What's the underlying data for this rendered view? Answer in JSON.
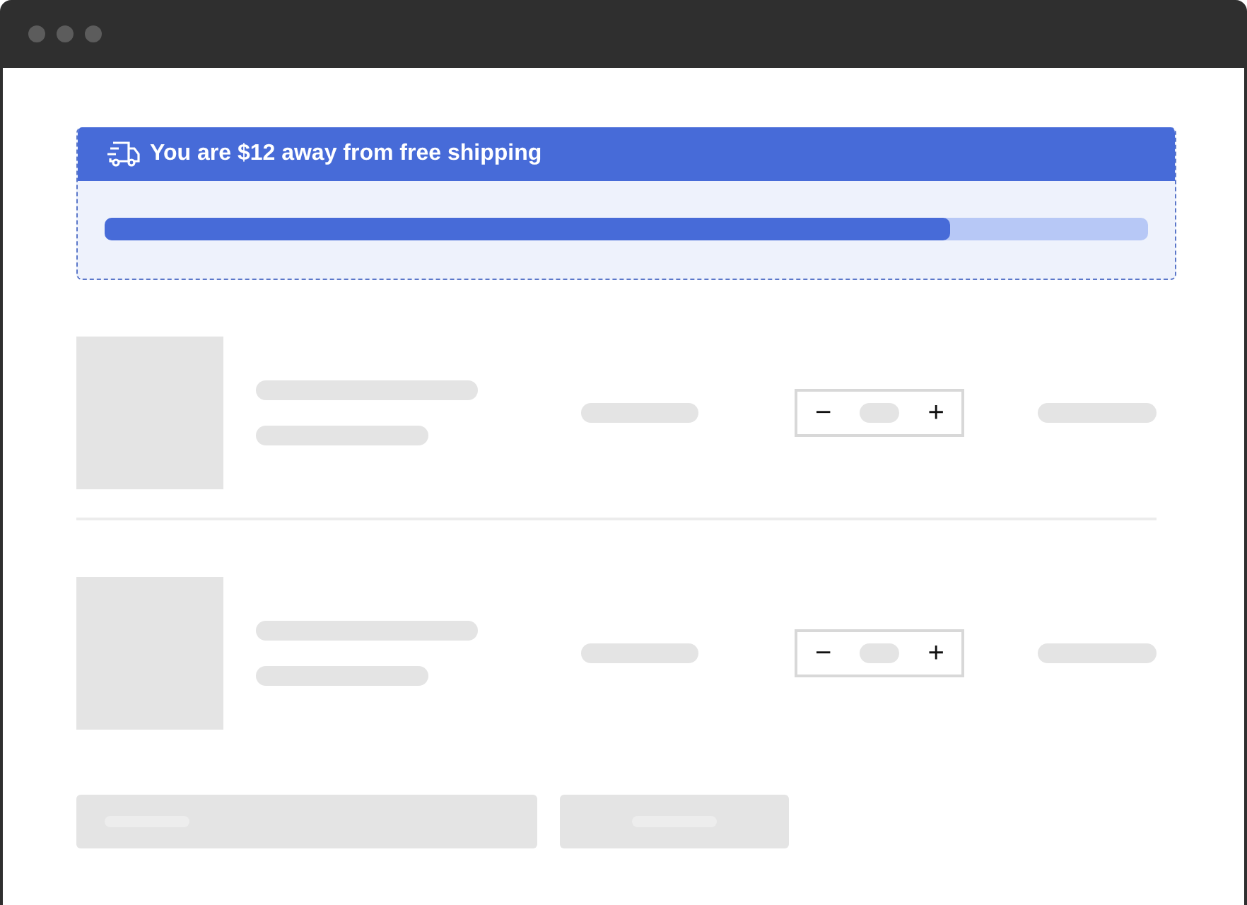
{
  "shipping_banner": {
    "message": "You are $12 away from free shipping",
    "progress": {
      "level": 0.81
    }
  },
  "cart_items": [
    {
      "decrement": "−",
      "increment": "+"
    },
    {
      "decrement": "−",
      "increment": "+"
    }
  ],
  "actions": [
    {
      "kind": "wide"
    },
    {
      "kind": "narrow"
    }
  ]
}
